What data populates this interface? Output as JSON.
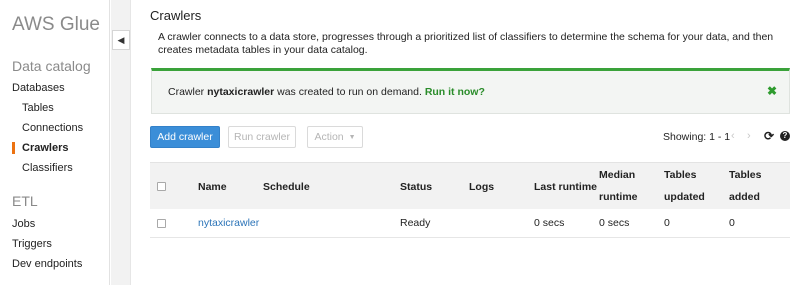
{
  "sidebar": {
    "brand": "AWS Glue",
    "data_catalog_title": "Data catalog",
    "databases": "Databases",
    "tables": "Tables",
    "connections": "Connections",
    "crawlers": "Crawlers",
    "classifiers": "Classifiers",
    "etl_title": "ETL",
    "jobs": "Jobs",
    "triggers": "Triggers",
    "dev_endpoints": "Dev endpoints",
    "collapse_icon": "triangle-left-icon"
  },
  "main": {
    "title": "Crawlers",
    "description": "A crawler connects to a data store, progresses through a prioritized list of classifiers to determine the schema for your data, and then creates metadata tables in your data catalog.",
    "flash": {
      "prefix": "Crawler ",
      "crawler_name": "nytaxicrawler",
      "suffix": " was created to run on demand.",
      "link": "Run it now?",
      "close_icon": "close-icon",
      "accent_color": "#3aa23a"
    },
    "toolbar": {
      "add_crawler": "Add crawler",
      "run_crawler": "Run crawler",
      "action": "Action",
      "showing": "Showing: 1 - 1",
      "prev_icon": "chevron-left-icon",
      "next_icon": "chevron-right-icon",
      "refresh_icon": "refresh-icon",
      "help_icon": "help-icon"
    },
    "table": {
      "columns": {
        "name": "Name",
        "schedule": "Schedule",
        "status": "Status",
        "logs": "Logs",
        "last_runtime": "Last runtime",
        "median_runtime_1": "Median",
        "median_runtime_2": "runtime",
        "tables_updated_1": "Tables",
        "tables_updated_2": "updated",
        "tables_added_1": "Tables",
        "tables_added_2": "added"
      },
      "rows": [
        {
          "name": "nytaxicrawler",
          "schedule": "",
          "status": "Ready",
          "logs": "",
          "last_runtime": "0 secs",
          "median_runtime": "0 secs",
          "tables_updated": "0",
          "tables_added": "0"
        }
      ]
    }
  },
  "colors": {
    "accent_orange": "#ec7211",
    "primary_blue": "#3b8ed8",
    "link_blue": "#2c74b8",
    "success_green": "#3aa23a"
  }
}
